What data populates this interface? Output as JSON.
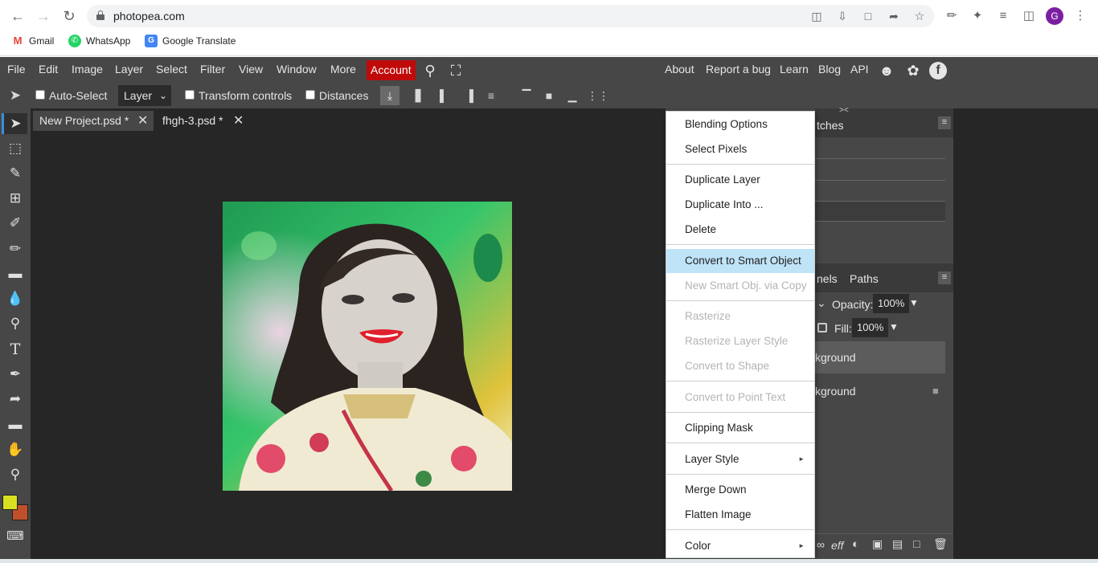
{
  "browser": {
    "url": "photopea.com",
    "profile_initial": "G",
    "bookmarks": [
      {
        "label": "Gmail"
      },
      {
        "label": "WhatsApp"
      },
      {
        "label": "Google Translate"
      }
    ]
  },
  "menubar": {
    "items": [
      "File",
      "Edit",
      "Image",
      "Layer",
      "Select",
      "Filter",
      "View",
      "Window",
      "More"
    ],
    "account": "Account",
    "right_links": [
      "About",
      "Report a bug",
      "Learn",
      "Blog",
      "API"
    ]
  },
  "options": {
    "auto_select": "Auto-Select",
    "layer_select": "Layer",
    "transform_controls": "Transform controls",
    "distances": "Distances"
  },
  "tabs": [
    {
      "label": "New Project.psd *"
    },
    {
      "label": "fhgh-3.psd *"
    }
  ],
  "panels": {
    "swatches_partial": "tches",
    "channels_partial": "nels",
    "paths": "Paths",
    "opacity_label": "Opacity:",
    "opacity_value": "100%",
    "fill_label": "Fill:",
    "fill_value": "100%",
    "layers": [
      {
        "name_partial": "kground"
      },
      {
        "name_partial": "kground"
      }
    ],
    "bottom_icons_text": "eff"
  },
  "context_menu": {
    "items": [
      {
        "label": "Blending Options",
        "disabled": false
      },
      {
        "label": "Select Pixels",
        "disabled": false
      },
      {
        "label": "Duplicate Layer",
        "disabled": false
      },
      {
        "label": "Duplicate Into ...",
        "disabled": false
      },
      {
        "label": "Delete",
        "disabled": false
      },
      {
        "label": "Convert to Smart Object",
        "disabled": false,
        "highlighted": true
      },
      {
        "label": "New Smart Obj. via Copy",
        "disabled": true
      },
      {
        "label": "Rasterize",
        "disabled": true
      },
      {
        "label": "Rasterize Layer Style",
        "disabled": true
      },
      {
        "label": "Convert to Shape",
        "disabled": true
      },
      {
        "label": "Convert to Point Text",
        "disabled": true
      },
      {
        "label": "Clipping Mask",
        "disabled": false
      },
      {
        "label": "Layer Style",
        "disabled": false,
        "submenu": true
      },
      {
        "label": "Merge Down",
        "disabled": false
      },
      {
        "label": "Flatten Image",
        "disabled": false
      },
      {
        "label": "Color",
        "disabled": false,
        "submenu": true
      }
    ]
  },
  "colors": {
    "foreground": "#d9e021",
    "background": "#c0502a",
    "account": "#c00a0a",
    "menu_highlight": "#bfe3f7"
  }
}
